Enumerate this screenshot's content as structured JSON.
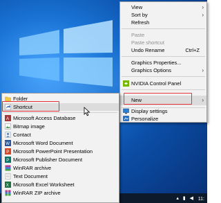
{
  "desktop_menu": {
    "items": [
      {
        "label": "View",
        "arrow": "›"
      },
      {
        "label": "Sort by",
        "arrow": "›"
      },
      {
        "label": "Refresh"
      },
      {
        "label": "Paste",
        "disabled": true
      },
      {
        "label": "Paste shortcut",
        "disabled": true
      },
      {
        "label": "Undo Rename",
        "shortcut": "Ctrl+Z"
      },
      {
        "label": "Graphics Properties..."
      },
      {
        "label": "Graphics Options",
        "arrow": "›"
      },
      {
        "label": "NVIDIA Control Panel"
      },
      {
        "label": "New",
        "arrow": "›"
      },
      {
        "label": "Display settings"
      },
      {
        "label": "Personalize"
      }
    ]
  },
  "new_submenu": {
    "items": [
      {
        "label": "Folder",
        "icon": "folder-icon"
      },
      {
        "label": "Shortcut",
        "icon": "shortcut-icon"
      },
      {
        "label": "Microsoft Access Database",
        "icon": "access-icon"
      },
      {
        "label": "Bitmap image",
        "icon": "bitmap-icon"
      },
      {
        "label": "Contact",
        "icon": "contact-icon"
      },
      {
        "label": "Microsoft Word Document",
        "icon": "word-icon"
      },
      {
        "label": "Microsoft PowerPoint Presentation",
        "icon": "powerpoint-icon"
      },
      {
        "label": "Microsoft Publisher Document",
        "icon": "publisher-icon"
      },
      {
        "label": "WinRAR archive",
        "icon": "winrar-icon"
      },
      {
        "label": "Text Document",
        "icon": "text-document-icon"
      },
      {
        "label": "Microsoft Excel Worksheet",
        "icon": "excel-icon"
      },
      {
        "label": "WinRAR ZIP archive",
        "icon": "winrar-zip-icon"
      }
    ]
  },
  "taskbar": {
    "time": "11:"
  },
  "colors": {
    "highlight_box": "#e5323b",
    "menu_bg": "#f2f2f2",
    "desktop_blue": "#0b4fa8"
  }
}
